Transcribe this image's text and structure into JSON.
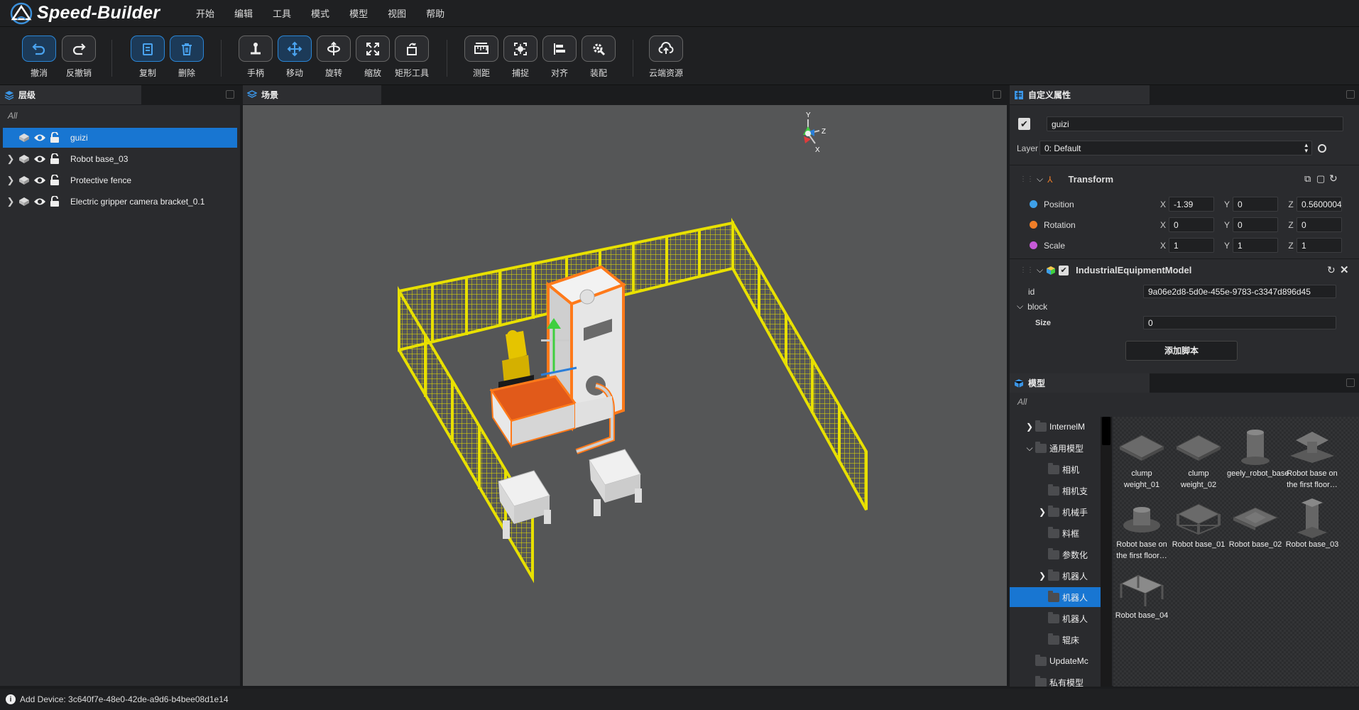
{
  "app": {
    "title": "Speed-Builder"
  },
  "menu": [
    "开始",
    "编辑",
    "工具",
    "模式",
    "模型",
    "视图",
    "帮助"
  ],
  "toolbar": [
    {
      "label": "撤消",
      "icon": "undo-icon",
      "active": true
    },
    {
      "label": "反撤销",
      "icon": "redo-icon",
      "active": false
    },
    {
      "label": "复制",
      "icon": "copy-icon",
      "active": true
    },
    {
      "label": "删除",
      "icon": "delete-icon",
      "active": true
    },
    {
      "label": "手柄",
      "icon": "handle-icon",
      "active": false
    },
    {
      "label": "移动",
      "icon": "move-icon",
      "active": true
    },
    {
      "label": "旋转",
      "icon": "rotate-icon",
      "active": false
    },
    {
      "label": "缩放",
      "icon": "scale-icon",
      "active": false
    },
    {
      "label": "矩形工具",
      "icon": "rect-tool-icon",
      "active": false
    },
    {
      "label": "测距",
      "icon": "measure-icon",
      "active": false
    },
    {
      "label": "捕捉",
      "icon": "snap-icon",
      "active": false
    },
    {
      "label": "对齐",
      "icon": "align-icon",
      "active": false
    },
    {
      "label": "装配",
      "icon": "assemble-icon",
      "active": false
    },
    {
      "label": "云端资源",
      "icon": "cloud-icon",
      "active": false
    }
  ],
  "tabs": {
    "hierarchy": "层级",
    "scene": "场景",
    "properties": "自定义属性",
    "models": "模型"
  },
  "hierarchy": {
    "filter": "All",
    "items": [
      {
        "name": "guizi",
        "selected": true,
        "expandable": false
      },
      {
        "name": "Robot base_03",
        "selected": false,
        "expandable": true
      },
      {
        "name": "Protective fence",
        "selected": false,
        "expandable": true
      },
      {
        "name": "Electric gripper camera bracket_0.1",
        "selected": false,
        "expandable": true
      }
    ]
  },
  "gizmo": {
    "x": "X",
    "y": "Y",
    "z": "Z"
  },
  "properties": {
    "object_name": "guizi",
    "layer_label": "Layer",
    "layer_value": "0: Default",
    "transform": {
      "title": "Transform",
      "position": {
        "label": "Position",
        "x": "-1.39",
        "y": "0",
        "z": "0.5600004",
        "color": "#3ea0e8"
      },
      "rotation": {
        "label": "Rotation",
        "x": "0",
        "y": "0",
        "z": "0",
        "color": "#f07e28"
      },
      "scale": {
        "label": "Scale",
        "x": "1",
        "y": "1",
        "z": "1",
        "color": "#c65ad8"
      },
      "axis_x": "X",
      "axis_y": "Y",
      "axis_z": "Z"
    },
    "component": {
      "title": "IndustrialEquipmentModel",
      "id_label": "id",
      "id_value": "9a06e2d8-5d0e-455e-9783-c3347d896d45",
      "block_label": "block",
      "size_label": "Size",
      "size_value": "0"
    },
    "add_script": "添加脚本"
  },
  "models": {
    "filter": "All",
    "tree": [
      {
        "name": "InternelM",
        "indent": 1,
        "arrow": "right",
        "selected": false
      },
      {
        "name": "通用模型",
        "indent": 1,
        "arrow": "down",
        "selected": false
      },
      {
        "name": "相机",
        "indent": 2,
        "arrow": "",
        "selected": false
      },
      {
        "name": "相机支",
        "indent": 2,
        "arrow": "",
        "selected": false
      },
      {
        "name": "机械手",
        "indent": 2,
        "arrow": "right",
        "selected": false
      },
      {
        "name": "料框",
        "indent": 2,
        "arrow": "",
        "selected": false
      },
      {
        "name": "参数化",
        "indent": 2,
        "arrow": "",
        "selected": false
      },
      {
        "name": "机器人",
        "indent": 2,
        "arrow": "right",
        "selected": false
      },
      {
        "name": "机器人",
        "indent": 2,
        "arrow": "",
        "selected": true
      },
      {
        "name": "机器人",
        "indent": 2,
        "arrow": "",
        "selected": false
      },
      {
        "name": "辊床",
        "indent": 2,
        "arrow": "",
        "selected": false
      },
      {
        "name": "UpdateMc",
        "indent": 1,
        "arrow": "",
        "selected": false
      },
      {
        "name": "私有模型",
        "indent": 1,
        "arrow": "",
        "selected": false
      }
    ],
    "items": [
      {
        "name": "clump weight_01",
        "icon": "plate-model-icon"
      },
      {
        "name": "clump weight_02",
        "icon": "plate-model-icon"
      },
      {
        "name": "geely_robot_base",
        "icon": "cylinder-model-icon"
      },
      {
        "name": "Robot base on the first floor…",
        "icon": "base-model-icon"
      },
      {
        "name": "Robot base on the first floor…",
        "icon": "round-base-model-icon"
      },
      {
        "name": "Robot base_01",
        "icon": "frame-base-model-icon"
      },
      {
        "name": "Robot base_02",
        "icon": "flat-base-model-icon"
      },
      {
        "name": "Robot base_03",
        "icon": "pillar-base-model-icon"
      },
      {
        "name": "Robot base_04",
        "icon": "table-base-model-icon"
      }
    ]
  },
  "status": {
    "text": "Add Device: 3c640f7e-48e0-42de-a9d6-b4bee08d1e14"
  },
  "colors": {
    "accent": "#1876d2",
    "fence": "#e8e000",
    "highlight": "#ff7a1a"
  }
}
